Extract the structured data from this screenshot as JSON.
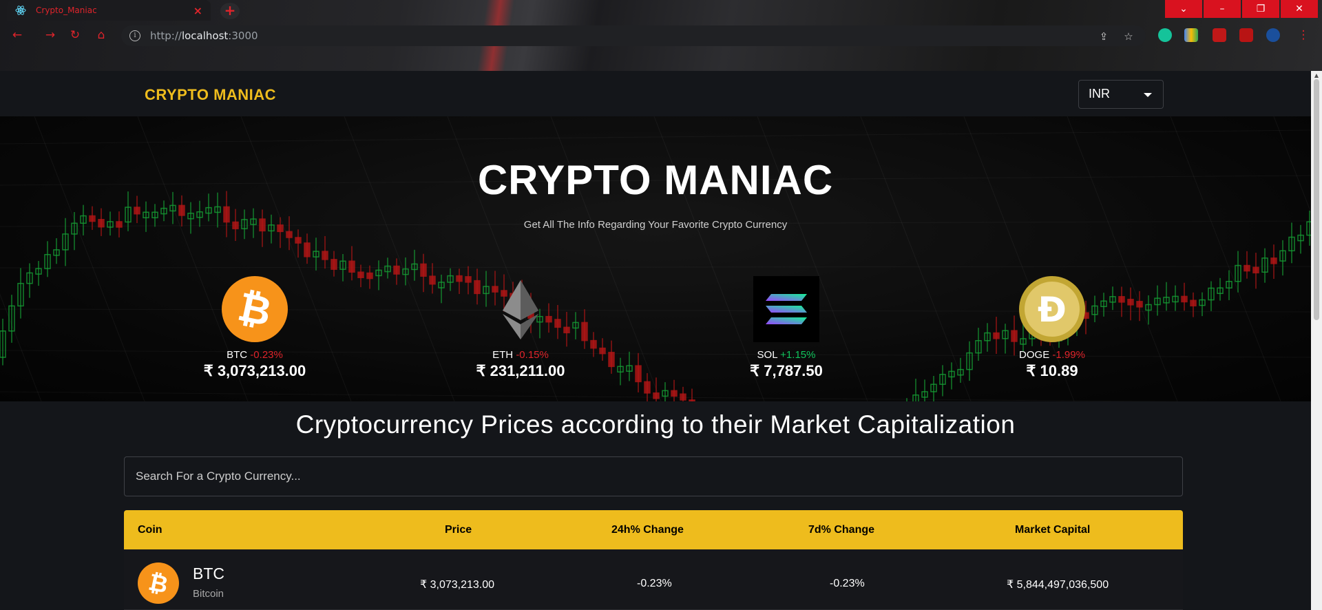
{
  "browser": {
    "tab_title": "Crypto_Maniac",
    "tab_close": "×",
    "new_tab": "+",
    "url_host": "localhost",
    "url_prefix": "http://",
    "url_port": ":3000",
    "win_min": "–",
    "win_restore": "❐",
    "win_close": "✕",
    "win_menu": "⌄"
  },
  "header": {
    "brand": "CRYPTO MANIAC",
    "currency": "INR"
  },
  "banner": {
    "title": "CRYPTO MANIAC",
    "subtitle": "Get All The Info Regarding Your Favorite Crypto Currency",
    "coins": [
      {
        "symbol": "BTC",
        "change": "-0.23%",
        "price": "₹ 3,073,213.00",
        "icon": "bitcoin-icon"
      },
      {
        "symbol": "ETH",
        "change": "-0.15%",
        "price": "₹ 231,211.00",
        "icon": "ethereum-icon"
      },
      {
        "symbol": "SOL",
        "change": "+1.15%",
        "price": "₹ 7,787.50",
        "icon": "solana-icon"
      },
      {
        "symbol": "DOGE",
        "change": "-1.99%",
        "price": "₹ 10.89",
        "icon": "dogecoin-icon"
      }
    ]
  },
  "section": {
    "title": "Cryptocurrency Prices according to their Market Capitalization"
  },
  "search": {
    "placeholder": "Search For a Crypto Currency..."
  },
  "table": {
    "headers": [
      "Coin",
      "Price",
      "24h% Change",
      "7d% Change",
      "Market Capital"
    ],
    "rows": [
      {
        "symbol": "BTC",
        "name": "Bitcoin",
        "price": "₹ 3,073,213.00",
        "change_24h": "-0.23%",
        "change_7d": "-0.23%",
        "market_cap": "₹ 5,844,497,036,500"
      }
    ]
  },
  "colors": {
    "accent": "#eebc1d",
    "negative": "#e0242b",
    "positive": "#10c45c",
    "background": "#14161a"
  }
}
